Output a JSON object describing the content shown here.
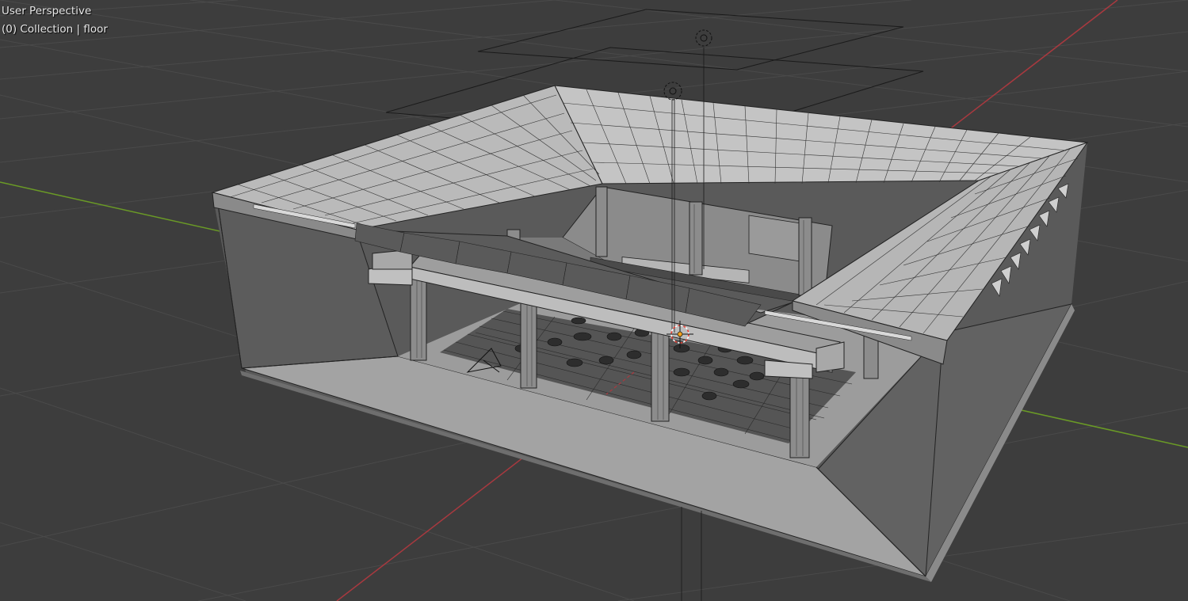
{
  "viewport": {
    "view_name": "User Perspective",
    "object_info": "(0) Collection | floor"
  },
  "colors": {
    "background": "#3d3d3d",
    "grid_line": "#484848",
    "x_axis": "#a8393f",
    "y_axis": "#6a9a26",
    "wall_inner": "#9a9a9a",
    "wall_outer": "#5e5e5e",
    "floor": "#a6a6a6",
    "roof": "#bcbcbc",
    "mesh_line": "#222222",
    "wire_line": "#1a1a1a",
    "origin": "#f0a020",
    "cursor_red": "#e8382c"
  },
  "icons": {
    "light_object": "light-icon",
    "camera_object": "camera-icon",
    "3d_cursor": "3d-cursor-icon",
    "object_origin": "origin-icon"
  }
}
